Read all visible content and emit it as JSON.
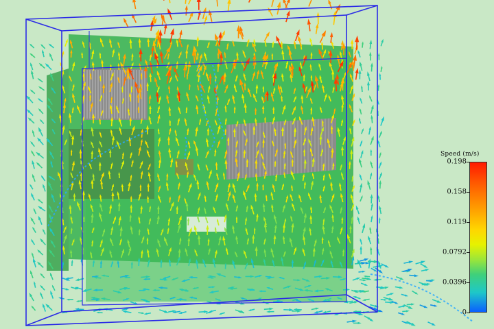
{
  "legend": {
    "title": "Speed (m/s)",
    "ticks": [
      {
        "label": "0.198",
        "fraction": 1.0
      },
      {
        "label": "0.158",
        "fraction": 0.8
      },
      {
        "label": "0.119",
        "fraction": 0.6
      },
      {
        "label": "0.0792",
        "fraction": 0.4
      },
      {
        "label": "0.0396",
        "fraction": 0.2
      },
      {
        "label": "0",
        "fraction": 0.0
      }
    ]
  },
  "colors": {
    "background": "#c9e8c6",
    "board": "#2fa84a",
    "heatsink": "#8a8a8a",
    "enclosure_frame": "#2828e0",
    "scale_max": "#ff1a00",
    "scale_min": "#0a60ff"
  }
}
